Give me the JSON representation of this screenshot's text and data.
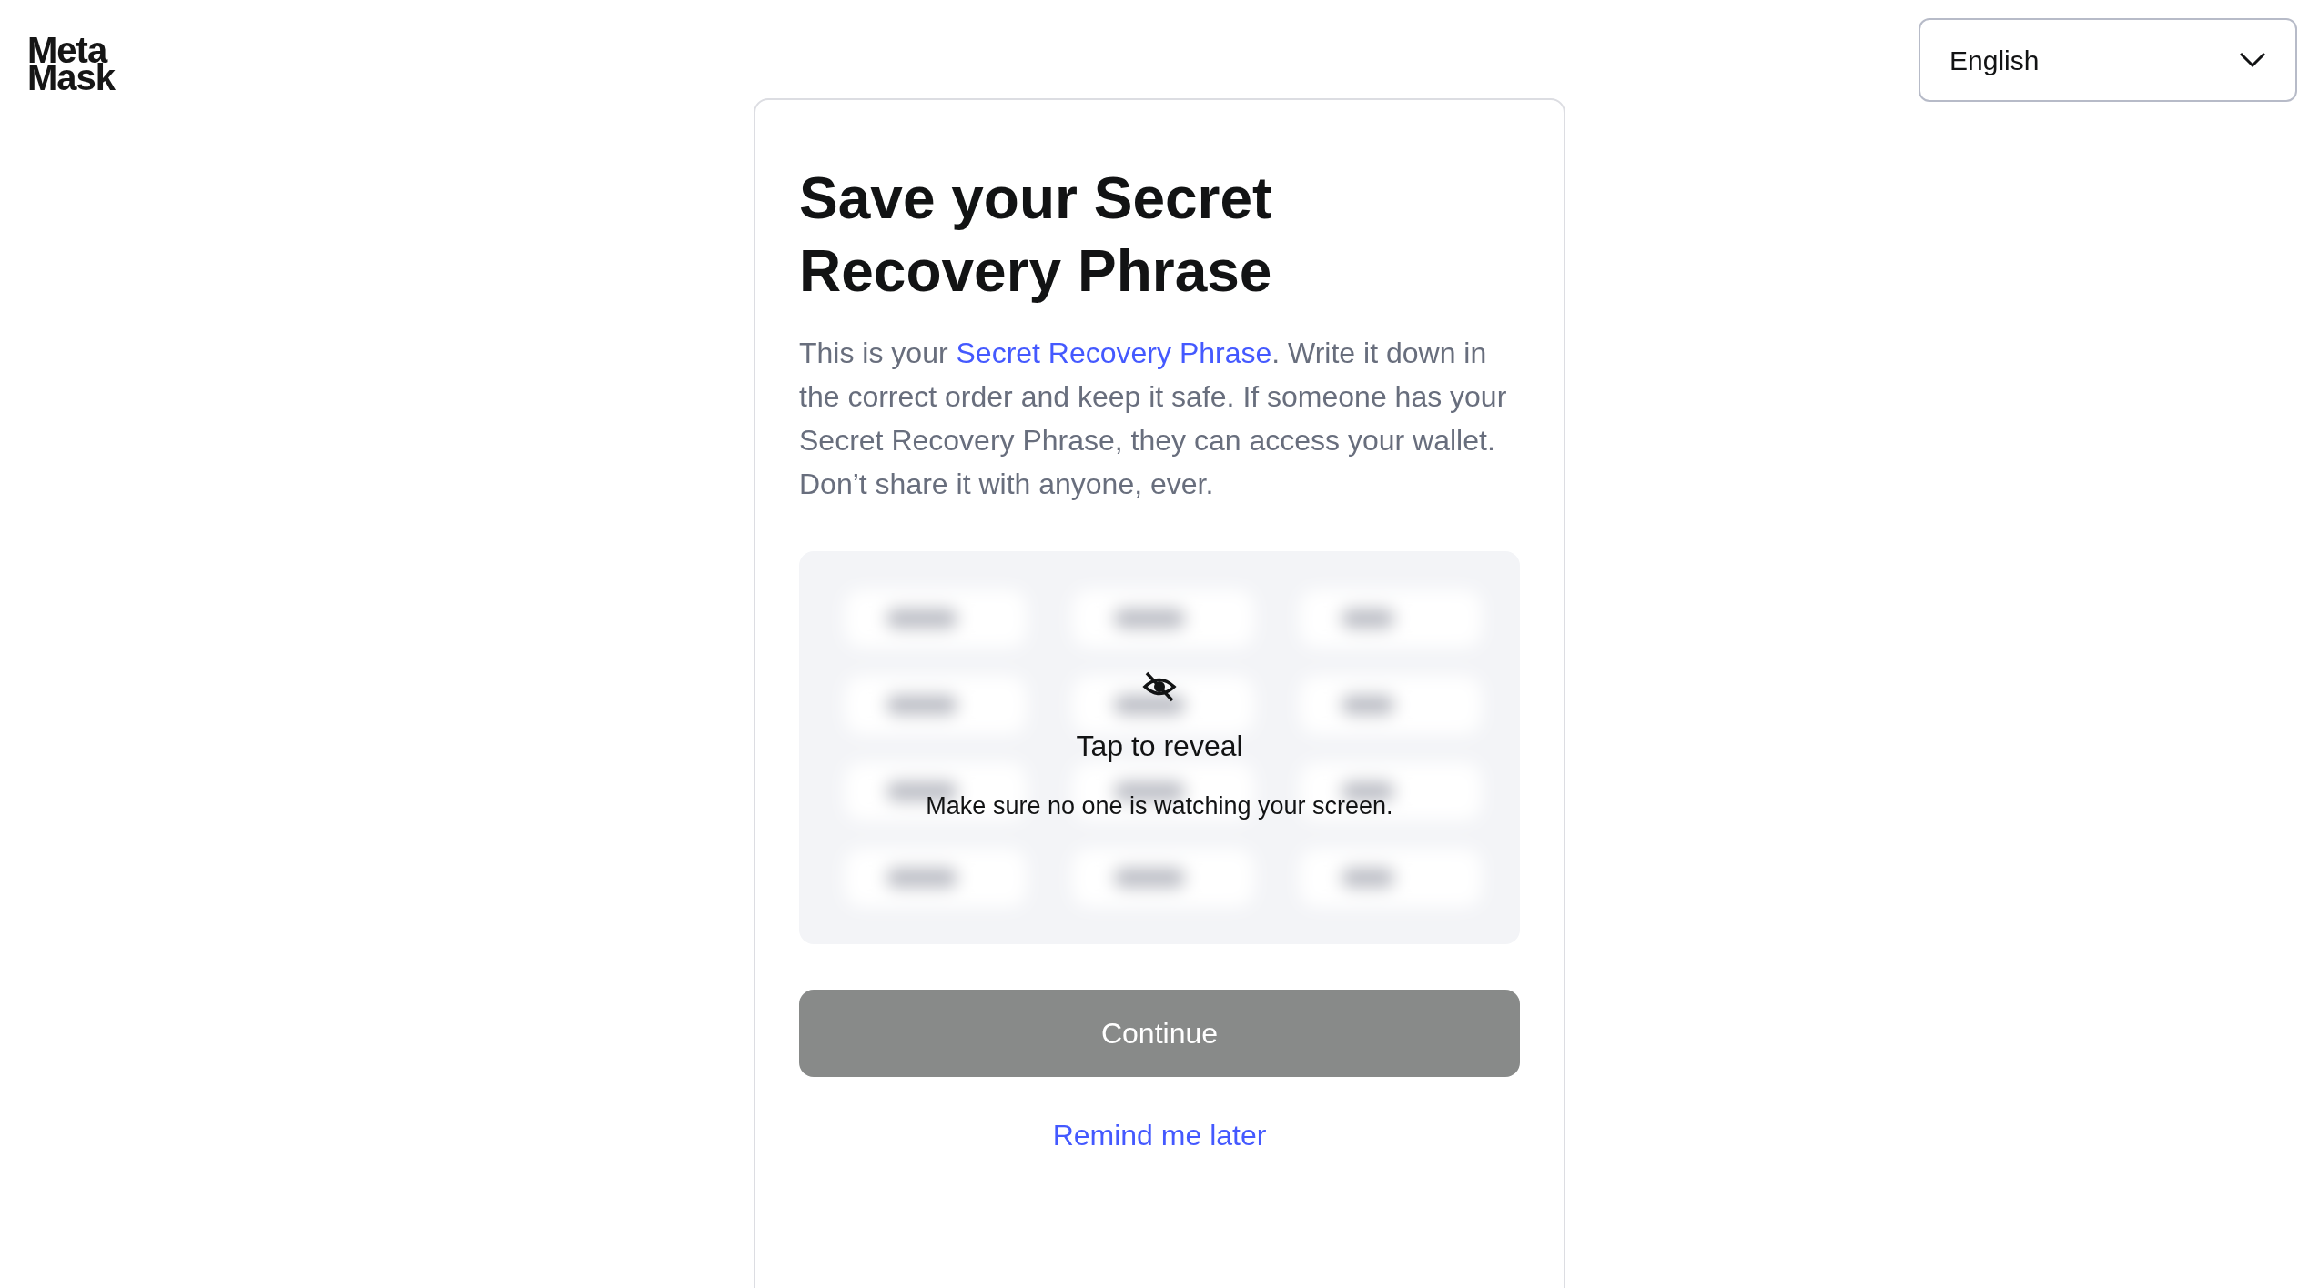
{
  "logo": {
    "lines": [
      "Meta",
      "Mask"
    ]
  },
  "language_select": {
    "value": "English"
  },
  "card": {
    "title": "Save your Secret Recovery Phrase",
    "description": {
      "before": "This is your ",
      "link": "Secret Recovery Phrase",
      "after": ". Write it down in the correct order and keep it safe. If someone has your Secret Recovery Phrase, they can access your wallet. Don’t share it with anyone, ever."
    },
    "reveal": {
      "title": "Tap to reveal",
      "hint": "Make sure no one is watching your screen."
    },
    "continue_button": {
      "label": "Continue",
      "disabled": true
    },
    "remind_link": "Remind me later"
  }
}
